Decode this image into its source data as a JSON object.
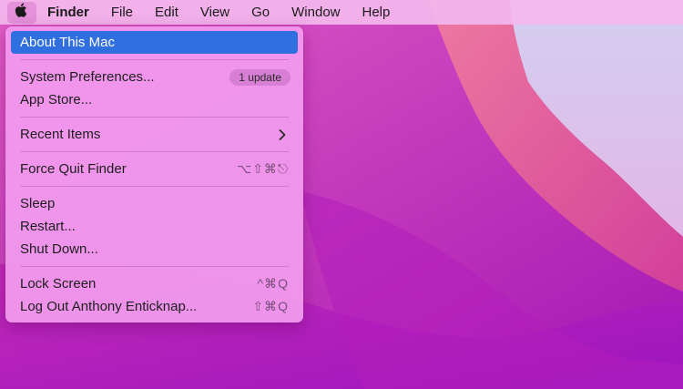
{
  "menubar": {
    "apple_icon": "apple-logo-icon",
    "app_name": "Finder",
    "menus": [
      "File",
      "Edit",
      "View",
      "Go",
      "Window",
      "Help"
    ]
  },
  "apple_menu": {
    "about": "About This Mac",
    "system_preferences": "System Preferences...",
    "update_badge": "1 update",
    "app_store": "App Store...",
    "recent_items": "Recent Items",
    "force_quit": "Force Quit Finder",
    "force_quit_shortcut": "⌥⇧⌘⎋",
    "sleep": "Sleep",
    "restart": "Restart...",
    "shut_down": "Shut Down...",
    "lock_screen": "Lock Screen",
    "lock_screen_shortcut": "^⌘Q",
    "log_out": "Log Out Anthony Enticknap...",
    "log_out_shortcut": "⇧⌘Q"
  },
  "colors": {
    "highlight": "#2f6fe0",
    "menu_bg": "#f098ec"
  }
}
